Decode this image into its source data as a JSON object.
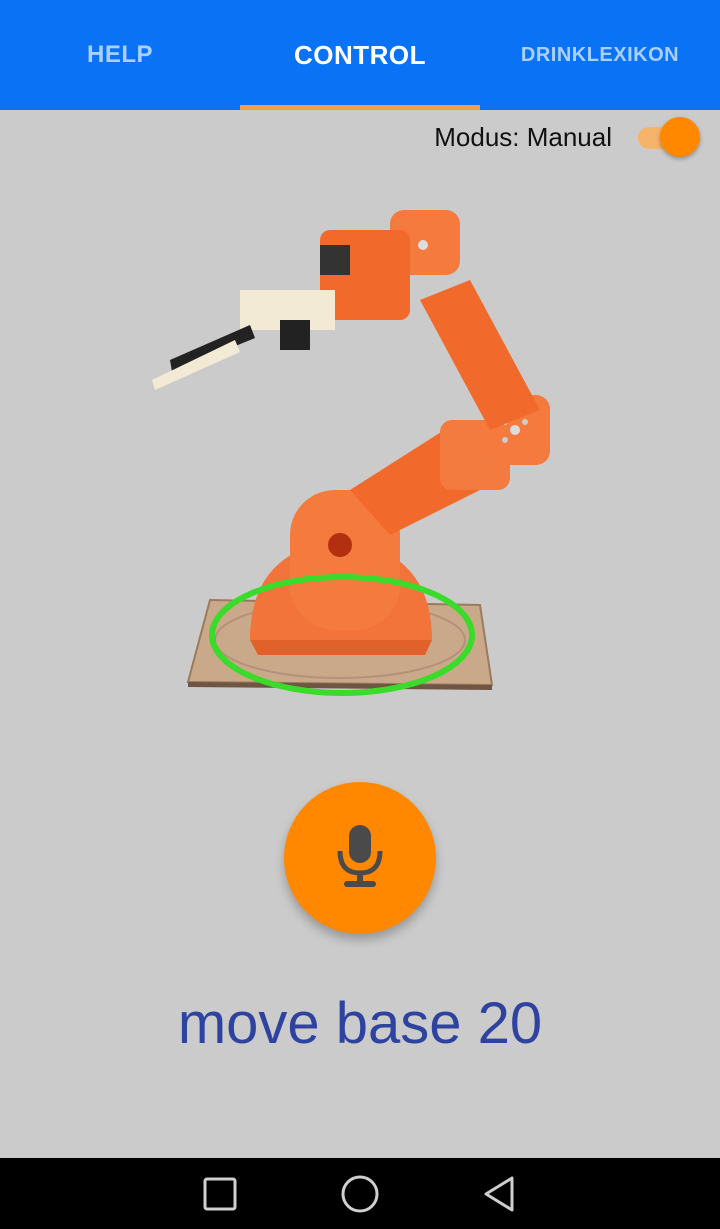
{
  "tabs": [
    {
      "label": "HELP",
      "active": false
    },
    {
      "label": "CONTROL",
      "active": true
    },
    {
      "label": "DRINKLEXIKON",
      "active": false
    }
  ],
  "mode": {
    "label": "Modus: Manual",
    "toggle_on": true
  },
  "command_text": "move base 20",
  "colors": {
    "app_bar": "#0a73f5",
    "accent": "#ff8800",
    "tab_indicator": "#f2a23a",
    "command_text": "#2e43a0",
    "background": "#cbcbcb",
    "highlight": "#3adb2a"
  },
  "icons": {
    "mic": "microphone-icon",
    "nav_recents": "square-icon",
    "nav_home": "circle-icon",
    "nav_back": "triangle-back-icon"
  }
}
